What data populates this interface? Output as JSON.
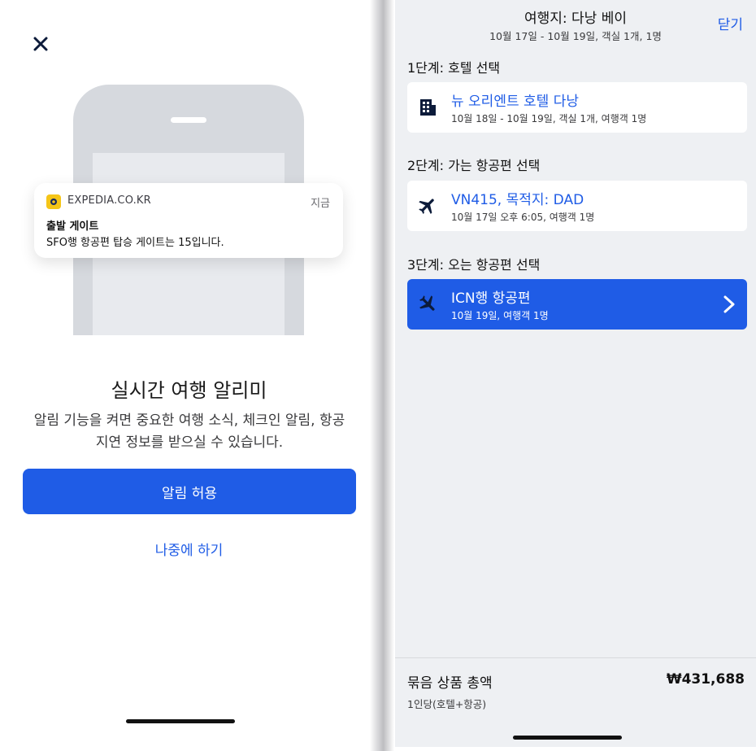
{
  "left": {
    "notification": {
      "app_name": "EXPEDIA.CO.KR",
      "time": "지금",
      "title": "출발 게이트",
      "body": "SFO행 항공편 탑승 게이트는 15입니다."
    },
    "headline": "실시간 여행 알리미",
    "description": "알림 기능을 켜면 중요한 여행 소식, 체크인 알림, 항공 지연 정보를 받으실 수 있습니다.",
    "allow_button": "알림 허용",
    "later_link": "나중에 하기"
  },
  "right": {
    "header": {
      "title": "여행지: 다낭 베이",
      "subtitle": "10월 17일 - 10월 19일, 객실 1개, 1명",
      "close": "닫기"
    },
    "steps": [
      {
        "label": "1단계: 호텔 선택",
        "title": "뉴 오리엔트 호텔 다낭",
        "sub": "10월 18일 - 10월 19일, 객실 1개, 여행객 1명",
        "icon": "hotel-icon"
      },
      {
        "label": "2단계: 가는 항공편 선택",
        "title": "VN415, 목적지: DAD",
        "sub": "10월 17일 오후 6:05, 여행객 1명",
        "icon": "plane-icon"
      },
      {
        "label": "3단계: 오는 항공편 선택",
        "title": "ICN행 항공편",
        "sub": "10월 19일, 여행객 1명",
        "icon": "plane-icon"
      }
    ],
    "footer": {
      "label": "묶음 상품 총액",
      "price": "₩431,688",
      "sub": "1인당(호텔+항공)"
    }
  },
  "colors": {
    "accent": "#1f5ce6",
    "background_right": "#eef0f3",
    "phone_illustration": "#d6d9de",
    "app_icon": "#f5c518"
  }
}
